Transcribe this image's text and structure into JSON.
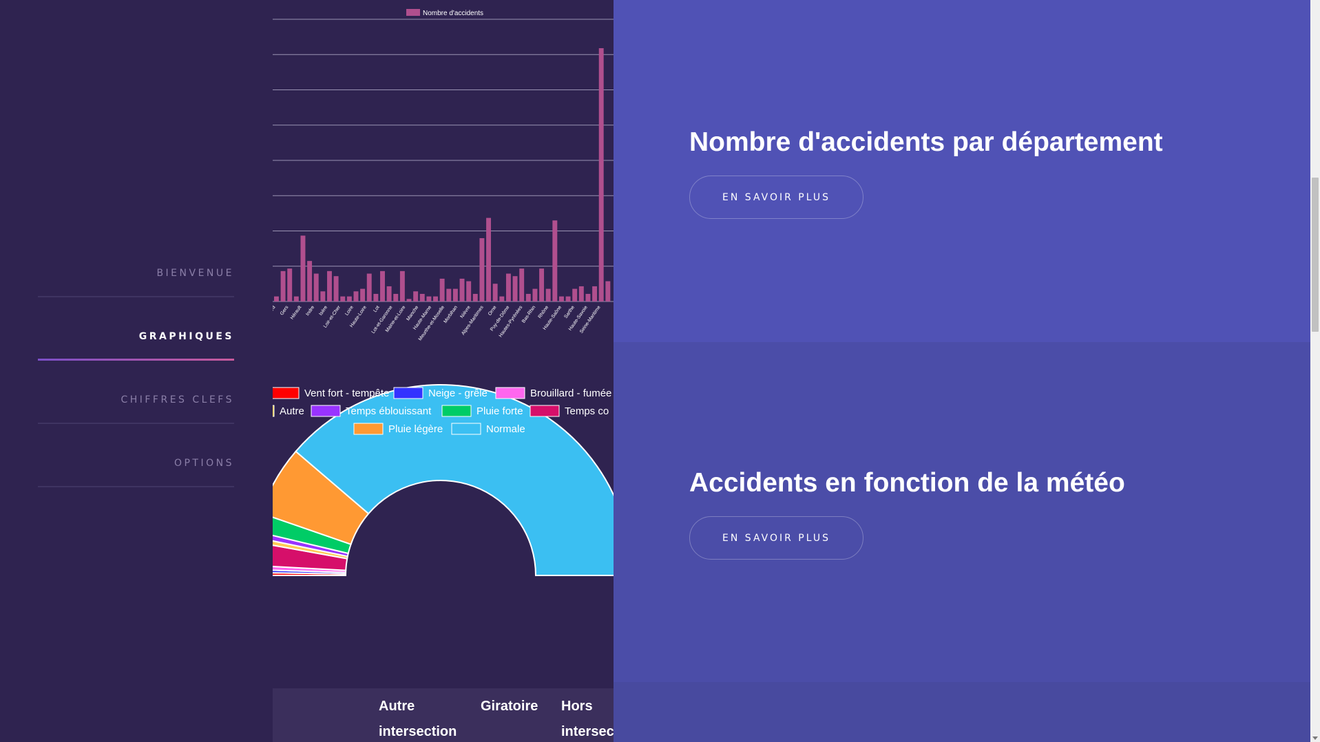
{
  "nav": {
    "items": [
      {
        "label": "BIENVENUE",
        "active": false
      },
      {
        "label": "GRAPHIQUES",
        "active": true
      },
      {
        "label": "CHIFFRES CLEFS",
        "active": false
      },
      {
        "label": "OPTIONS",
        "active": false
      }
    ]
  },
  "panels": [
    {
      "title": "Nombre d'accidents par département",
      "button": "EN SAVOIR PLUS",
      "color": "#5052b5"
    },
    {
      "title": "Accidents en fonction de la météo",
      "button": "EN SAVOIR PLUS",
      "color": "#4b4da8"
    },
    {
      "color": "#484a9f"
    }
  ],
  "colors": {
    "background": "#2f2350",
    "bar": "#b04f8e",
    "accent": "#7b4fc8"
  },
  "chart_data": [
    {
      "type": "bar",
      "legend": [
        "Nombre d'accidents"
      ],
      "categories": [
        "Gard",
        "Gers",
        "Hérault",
        "Indre",
        "Isère",
        "Loir-et-Cher",
        "Loire",
        "Haute-Loire",
        "Lot",
        "Lot-et-Garonne",
        "Maine-et-Loire",
        "Manche",
        "Haute-Marne",
        "Meurthe-et-Moselle",
        "Morbihan",
        "Nièvre",
        "Alpes-Maritimes",
        "Orne",
        "Puy-de-Dôme",
        "Hautes-Pyrénées",
        "Bas-Rhin",
        "Rhône",
        "Haute-Saône",
        "Sarthe",
        "Haute-Savoie",
        "Seine-Maritime"
      ],
      "values": [
        2,
        12,
        13,
        2,
        26,
        16,
        11,
        4,
        12,
        10,
        2,
        2,
        4,
        5,
        11,
        3,
        12,
        6,
        3,
        12,
        1,
        4,
        3,
        2,
        2,
        9,
        5,
        5,
        9,
        8,
        3,
        25,
        33,
        7,
        2,
        11,
        10,
        13,
        3,
        5,
        13,
        5,
        32,
        2,
        2,
        5,
        6,
        3,
        6,
        100,
        8
      ],
      "grid": true
    },
    {
      "type": "pie",
      "subtype": "half-doughnut",
      "labels": [
        "Vent fort - tempête",
        "Neige - grêle",
        "Brouillard - fumée",
        "Temps couvert",
        "Autre",
        "Temps éblouissant",
        "Pluie forte",
        "Pluie légère",
        "Normale"
      ],
      "legend_labels": [
        "Vent fort - tempête",
        "Neige - grêle",
        "Brouillard - fumée",
        "Autre",
        "Temps éblouissant",
        "Pluie forte",
        "Temps co",
        "Pluie légère",
        "Normale"
      ],
      "values": [
        0.5,
        0.5,
        0.7,
        4.0,
        0.8,
        1.0,
        3.2,
        12.0,
        78.0
      ],
      "colors": [
        "#ff0000",
        "#3333ff",
        "#ff66ee",
        "#d60f6a",
        "#ffcc55",
        "#9933ff",
        "#00cc66",
        "#ff9933",
        "#3bbff2"
      ],
      "legend_position": "bottom"
    }
  ],
  "table": {
    "headers": [
      "Autre intersection",
      "Giratoire",
      "Hors intersection"
    ]
  }
}
